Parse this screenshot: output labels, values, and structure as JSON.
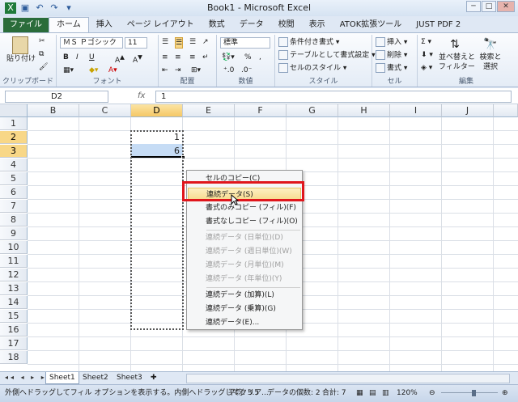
{
  "window": {
    "title": "Book1 - Microsoft Excel"
  },
  "tabs": [
    "ファイル",
    "ホーム",
    "挿入",
    "ページ レイアウト",
    "数式",
    "データ",
    "校閲",
    "表示",
    "ATOK拡張ツール",
    "JUST PDF 2"
  ],
  "ribbon": {
    "clipboard": {
      "label": "クリップボード",
      "paste": "貼り付け"
    },
    "font": {
      "label": "フォント",
      "name": "ＭＳ Ｐゴシック",
      "size": "11",
      "bold": "B",
      "italic": "I",
      "underline": "U"
    },
    "alignment": {
      "label": "配置"
    },
    "number": {
      "label": "数値",
      "format": "標準",
      "percent": "%"
    },
    "styles": {
      "label": "スタイル",
      "conditional": "条件付き書式",
      "table": "テーブルとして書式設定",
      "cell": "セルのスタイル"
    },
    "cells": {
      "label": "セル",
      "insert": "挿入",
      "delete": "削除",
      "format": "書式"
    },
    "editing": {
      "label": "編集",
      "sort": "並べ替えと",
      "sort2": "フィルター",
      "find": "検索と",
      "find2": "選択"
    }
  },
  "formula": {
    "namebox": "D2",
    "fx": "fx",
    "value": "1"
  },
  "columns": [
    "B",
    "C",
    "D",
    "E",
    "F",
    "G",
    "H",
    "I",
    "J"
  ],
  "rows": [
    "1",
    "2",
    "3",
    "4",
    "5",
    "6",
    "7",
    "8",
    "9",
    "10",
    "11",
    "12",
    "13",
    "14",
    "15",
    "16",
    "17",
    "18"
  ],
  "cells": {
    "d2": "1",
    "d3": "6"
  },
  "context_menu": [
    {
      "label": "セルのコピー(C)",
      "disabled": false
    },
    {
      "label": "連続データ(S)",
      "disabled": false
    },
    {
      "label": "書式のみコピー (フィル)(F)",
      "disabled": false
    },
    {
      "label": "書式なしコピー (フィル)(O)",
      "disabled": false
    },
    {
      "label": "連続データ (日単位)(D)",
      "disabled": true
    },
    {
      "label": "連続データ (週日単位)(W)",
      "disabled": true
    },
    {
      "label": "連続データ (月単位)(M)",
      "disabled": true
    },
    {
      "label": "連続データ (年単位)(Y)",
      "disabled": true
    },
    {
      "label": "連続データ (加算)(L)",
      "disabled": false
    },
    {
      "label": "連続データ (乗算)(G)",
      "disabled": false
    },
    {
      "label": "連続データ(E)...",
      "disabled": false
    }
  ],
  "sheets": [
    "Sheet1",
    "Sheet2",
    "Sheet3"
  ],
  "status": {
    "message": "外側へドラッグしてフィル オプションを表示する。内側へドラッグしてクリア...",
    "average": "平均: 3.5",
    "count": "データの個数: 2",
    "sum": "合計: 7",
    "zoom": "120%"
  },
  "colors": {
    "highlight": "#e0161c",
    "file_tab": "#2a6c3a"
  }
}
